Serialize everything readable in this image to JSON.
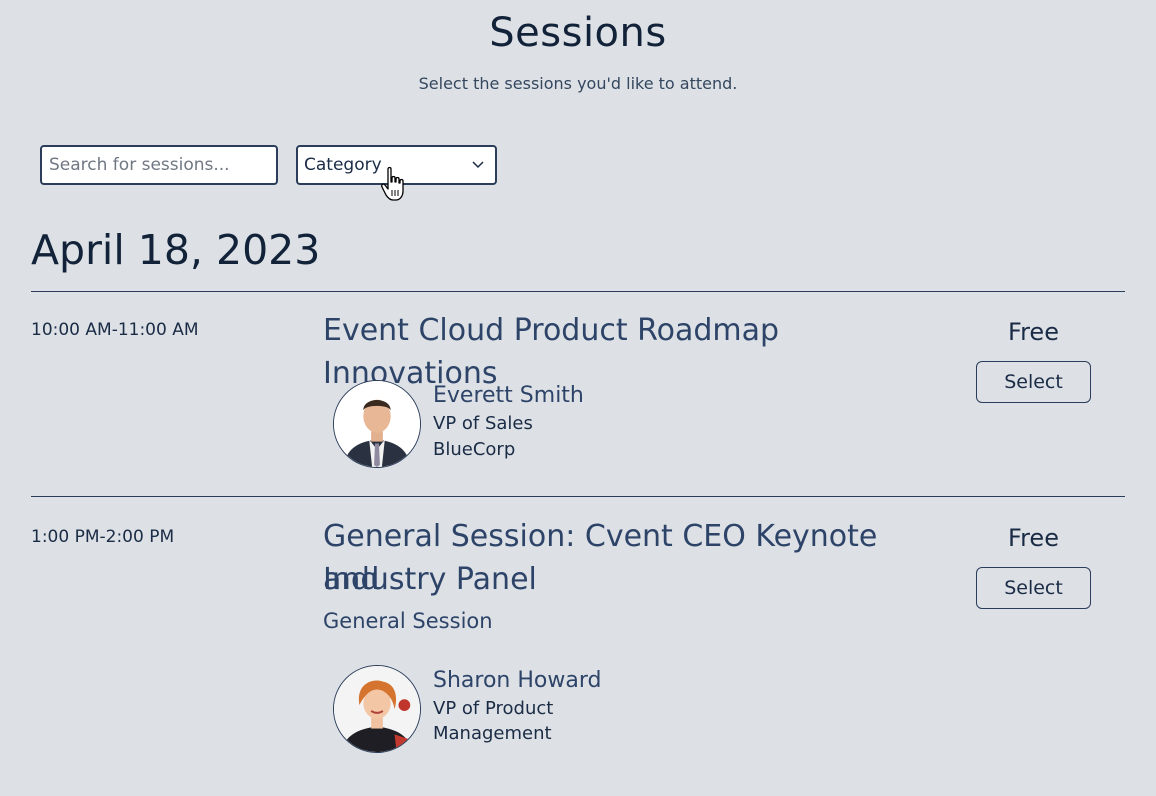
{
  "header": {
    "title": "Sessions",
    "subtitle": "Select the sessions you'd like to attend."
  },
  "filters": {
    "search_placeholder": "Search for sessions...",
    "category_label": "Category"
  },
  "date_heading": "April 18, 2023",
  "sessions": [
    {
      "time": "10:00 AM-11:00 AM",
      "title": "Event Cloud Product Roadmap Innovations",
      "price": "Free",
      "button": "Select",
      "speaker": {
        "name": "Everett Smith",
        "role": "VP of Sales",
        "company": "BlueCorp"
      }
    },
    {
      "time": "1:00 PM-2:00 PM",
      "title_line1": "General Session: Cvent CEO Keynote and",
      "title_line2": "Industry Panel",
      "category": "General Session",
      "price": "Free",
      "button": "Select",
      "speaker": {
        "name": "Sharon Howard",
        "role_line1": "VP of Product",
        "role_line2": "Management"
      }
    }
  ],
  "icons": {
    "dropdown": "chevron-down-icon",
    "cursor": "hand-pointer-cursor-icon"
  },
  "colors": {
    "background": "#dde1e6",
    "title_text": "#2d4468",
    "border": "#2b3d5a"
  }
}
